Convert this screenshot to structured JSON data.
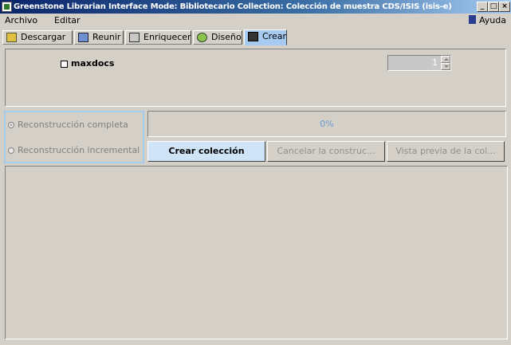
{
  "window": {
    "title": "Greenstone Librarian Interface  Mode: Bibliotecario  Collection: Colección de muestra CDS/ISIS (isis-e)",
    "minimize": "_",
    "maximize": "□",
    "close": "×"
  },
  "menu": {
    "archivo": "Archivo",
    "editar": "Editar",
    "ayuda": "Ayuda"
  },
  "tabs": [
    {
      "label": "Descargar",
      "icon": "download-icon"
    },
    {
      "label": "Reunir",
      "icon": "gather-icon"
    },
    {
      "label": "Enriquecer",
      "icon": "enrich-icon"
    },
    {
      "label": "Diseño",
      "icon": "gear-icon"
    },
    {
      "label": "Crear",
      "icon": "create-icon"
    }
  ],
  "active_tab": "Crear",
  "options": {
    "maxdocs_label": "maxdocs",
    "maxdocs_checked": false,
    "maxdocs_value": "1"
  },
  "rebuild": {
    "full_label": "Reconstrucción completa",
    "incremental_label": "Reconstrucción incremental",
    "selected": "full"
  },
  "progress": {
    "text": "0%",
    "value": 0
  },
  "buttons": {
    "build": "Crear colección",
    "cancel": "Cancelar la construc...",
    "preview": "Vista previa de la col..."
  }
}
